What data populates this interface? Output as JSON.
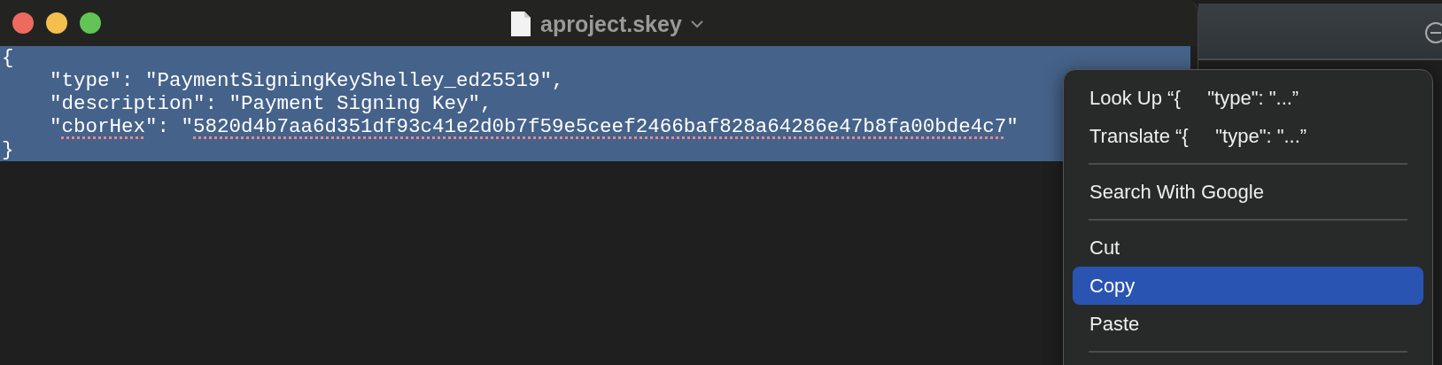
{
  "window": {
    "title": "aproject.skey"
  },
  "editor": {
    "lines": [
      {
        "selected": true,
        "segments": [
          {
            "text": "{",
            "misspelled": false
          }
        ]
      },
      {
        "selected": true,
        "segments": [
          {
            "text": "    \"type\": \"PaymentSigningKeyShelley_ed25519\",",
            "misspelled": false
          }
        ]
      },
      {
        "selected": true,
        "segments": [
          {
            "text": "    \"description\": \"Payment Signing Key\",",
            "misspelled": false
          }
        ]
      },
      {
        "selected": true,
        "segments": [
          {
            "text": "    \"",
            "misspelled": false
          },
          {
            "text": "cborHex",
            "misspelled": true
          },
          {
            "text": "\": \"",
            "misspelled": false
          },
          {
            "text": "5820d4b7aa6d351df93c41e2d0b7f59e5ceef2466baf828a64286e47b8fa00bde4c7",
            "misspelled": true
          },
          {
            "text": "\"",
            "misspelled": false
          }
        ]
      },
      {
        "selected": true,
        "segments": [
          {
            "text": "}",
            "misspelled": false
          }
        ]
      }
    ]
  },
  "context_menu": {
    "items": [
      {
        "kind": "item",
        "label": "Look Up “{     \"type\": \"...”",
        "selected": false
      },
      {
        "kind": "item",
        "label": "Translate “{     \"type\": \"...”",
        "selected": false
      },
      {
        "kind": "separator"
      },
      {
        "kind": "item",
        "label": "Search With Google",
        "selected": false
      },
      {
        "kind": "separator"
      },
      {
        "kind": "item",
        "label": "Cut",
        "selected": false
      },
      {
        "kind": "item",
        "label": "Copy",
        "selected": true
      },
      {
        "kind": "item",
        "label": "Paste",
        "selected": false
      },
      {
        "kind": "separator"
      }
    ]
  }
}
